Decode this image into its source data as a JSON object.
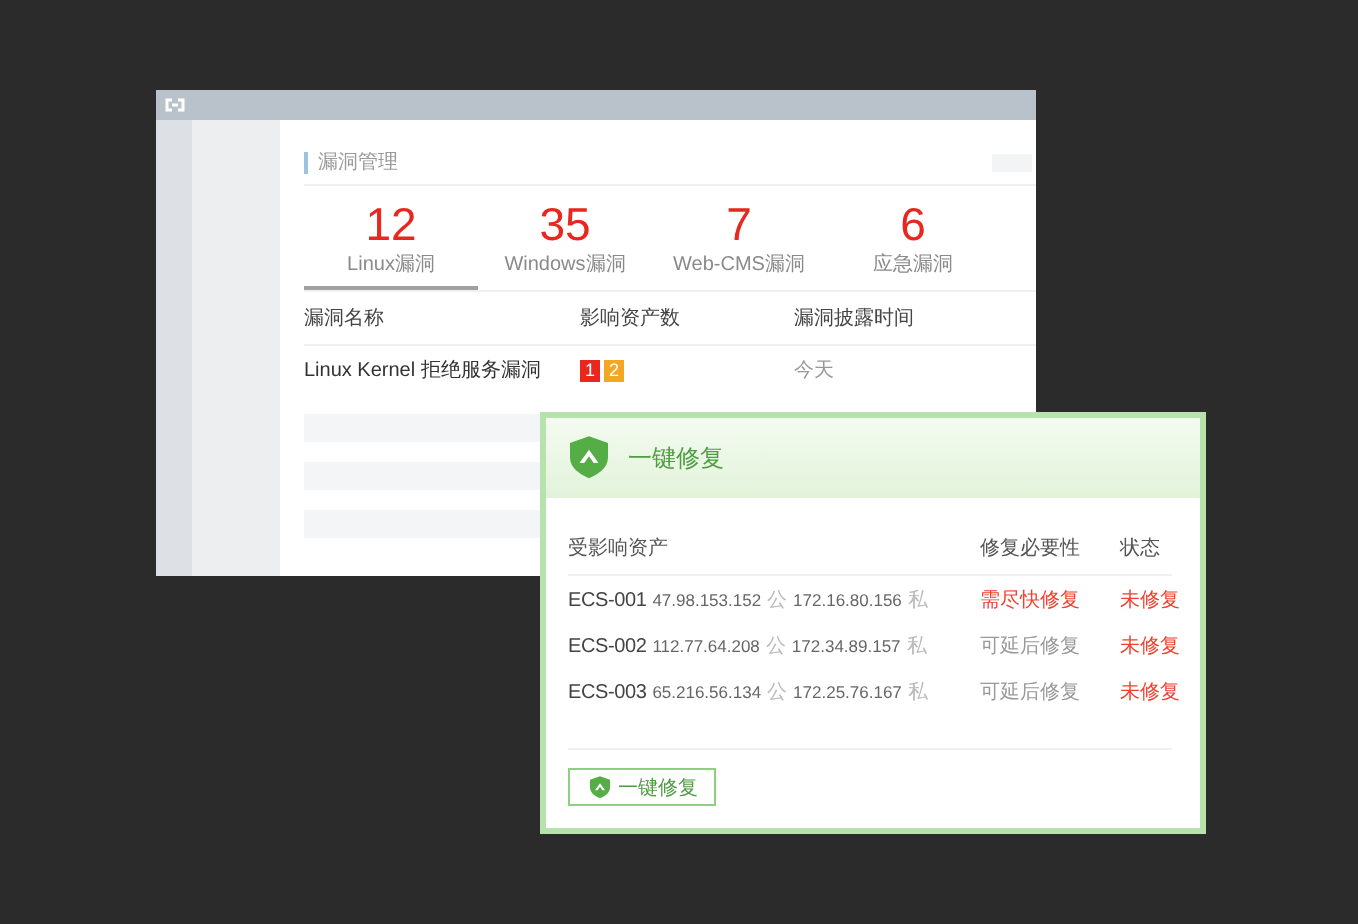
{
  "back_window": {
    "section_title": "漏洞管理",
    "stats": [
      {
        "value": "12",
        "label": "Linux漏洞",
        "selected": true
      },
      {
        "value": "35",
        "label": "Windows漏洞",
        "selected": false
      },
      {
        "value": "7",
        "label": "Web-CMS漏洞",
        "selected": false
      },
      {
        "value": "6",
        "label": "应急漏洞",
        "selected": false
      }
    ],
    "table": {
      "columns": [
        "漏洞名称",
        "影响资产数",
        "漏洞披露时间"
      ],
      "rows": [
        {
          "name": "Linux Kernel 拒绝服务漏洞",
          "badges": [
            {
              "text": "1",
              "color": "#e8271f"
            },
            {
              "text": "2",
              "color": "#f5a623"
            }
          ],
          "time": "今天"
        }
      ]
    }
  },
  "repair_dialog": {
    "title": "一键修复",
    "columns": [
      "受影响资产",
      "修复必要性",
      "状态"
    ],
    "rows": [
      {
        "asset": "ECS-001",
        "public_ip": "47.98.153.152",
        "public_tag": "公",
        "private_ip": "172.16.80.156",
        "private_tag": "私",
        "necessity": "需尽快修复",
        "urgent": true,
        "status": "未修复"
      },
      {
        "asset": "ECS-002",
        "public_ip": "112.77.64.208",
        "public_tag": "公",
        "private_ip": "172.34.89.157",
        "private_tag": "私",
        "necessity": "可延后修复",
        "urgent": false,
        "status": "未修复"
      },
      {
        "asset": "ECS-003",
        "public_ip": "65.216.56.134",
        "public_tag": "公",
        "private_ip": "172.25.76.167",
        "private_tag": "私",
        "necessity": "可延后修复",
        "urgent": false,
        "status": "未修复"
      }
    ],
    "button": "一键修复"
  }
}
